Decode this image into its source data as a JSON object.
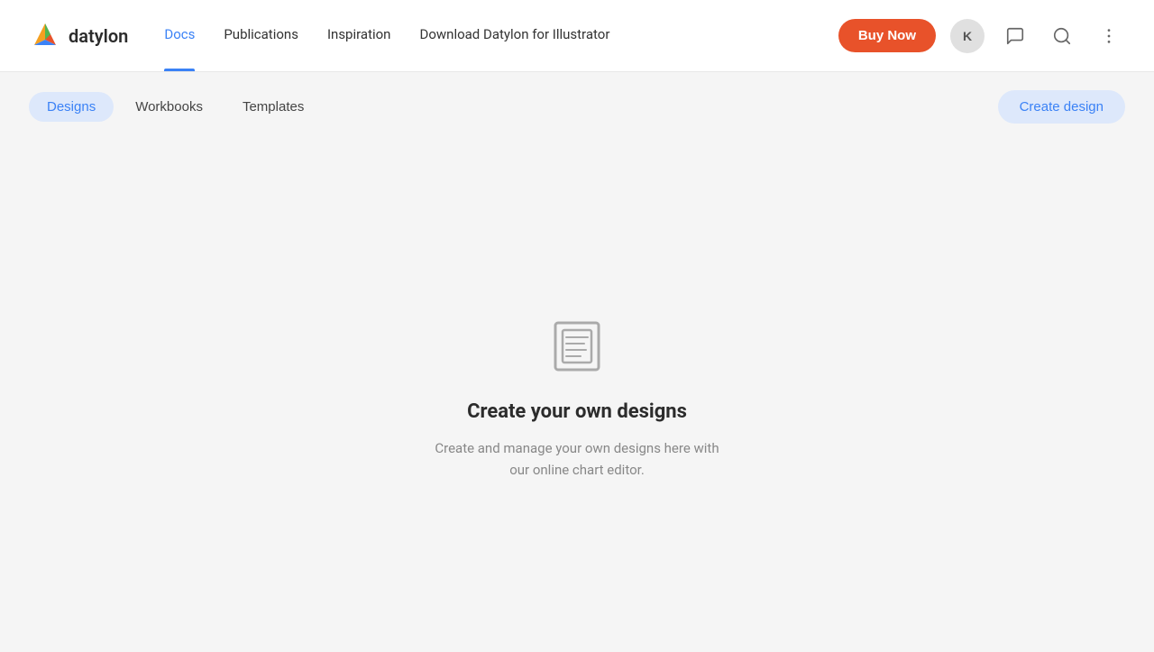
{
  "navbar": {
    "logo_text": "datylon",
    "nav_links": [
      {
        "id": "docs",
        "label": "Docs",
        "active": true
      },
      {
        "id": "publications",
        "label": "Publications",
        "active": false
      },
      {
        "id": "inspiration",
        "label": "Inspiration",
        "active": false
      },
      {
        "id": "download",
        "label": "Download Datylon for Illustrator",
        "active": false
      }
    ],
    "buy_now_label": "Buy Now",
    "avatar_label": "K"
  },
  "tabs_bar": {
    "tabs": [
      {
        "id": "designs",
        "label": "Designs",
        "active": true
      },
      {
        "id": "workbooks",
        "label": "Workbooks",
        "active": false
      },
      {
        "id": "templates",
        "label": "Templates",
        "active": false
      }
    ],
    "create_design_label": "Create design"
  },
  "empty_state": {
    "title": "Create your own designs",
    "description": "Create and manage your own designs here with our online chart editor."
  }
}
